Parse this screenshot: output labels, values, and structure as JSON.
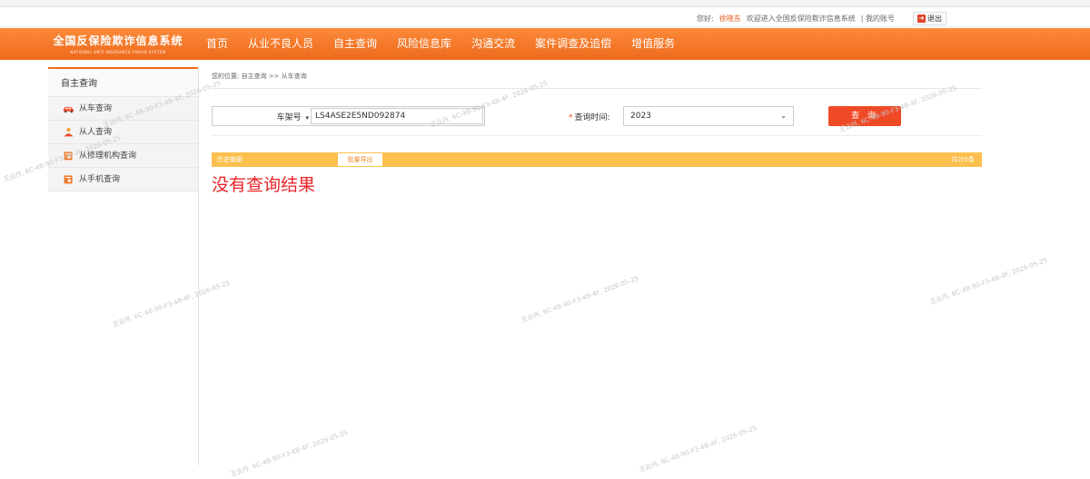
{
  "topbar": {
    "greeting": "您好:",
    "username": "徐晓东",
    "welcome": "欢迎进入全国反保险欺诈信息系统",
    "my_account": "| 我的账号",
    "logout_label": "退出"
  },
  "brand": {
    "name_cn": "全国反保险欺诈信息系统",
    "name_en": "NATIONAL ANTI INSURANCE FRAUD SYSTEM"
  },
  "nav": {
    "items": [
      "首页",
      "从业不良人员",
      "自主查询",
      "风险信息库",
      "沟通交流",
      "案件调查及追偿",
      "增值服务"
    ]
  },
  "sidebar": {
    "title": "自主查询",
    "items": [
      {
        "label": "从车查询",
        "icon": "car-icon"
      },
      {
        "label": "从人查询",
        "icon": "person-icon"
      },
      {
        "label": "从修理机构查询",
        "icon": "repair-shop-icon"
      },
      {
        "label": "从手机查询",
        "icon": "phone-icon"
      }
    ]
  },
  "breadcrumb": "您的位置: 自主查询 >> 从车查询",
  "query": {
    "field_select": "车架号",
    "field_value": "LS4ASE2E5ND092874",
    "time_label": "查询时间:",
    "time_value": "2023",
    "button_label": "查 询"
  },
  "results": {
    "history_label": "历史赔案",
    "export_label": "批量导出",
    "total_label": "共计0条",
    "empty_text": "没有查询结果"
  },
  "watermark": "王云丹, 6C-4B-90-F3-4B-4F, 2026-05-25",
  "colors": {
    "accent": "#ee6a1c",
    "bar": "#fbc04e",
    "button": "#ef4a26",
    "empty_text": "#e8252b"
  }
}
